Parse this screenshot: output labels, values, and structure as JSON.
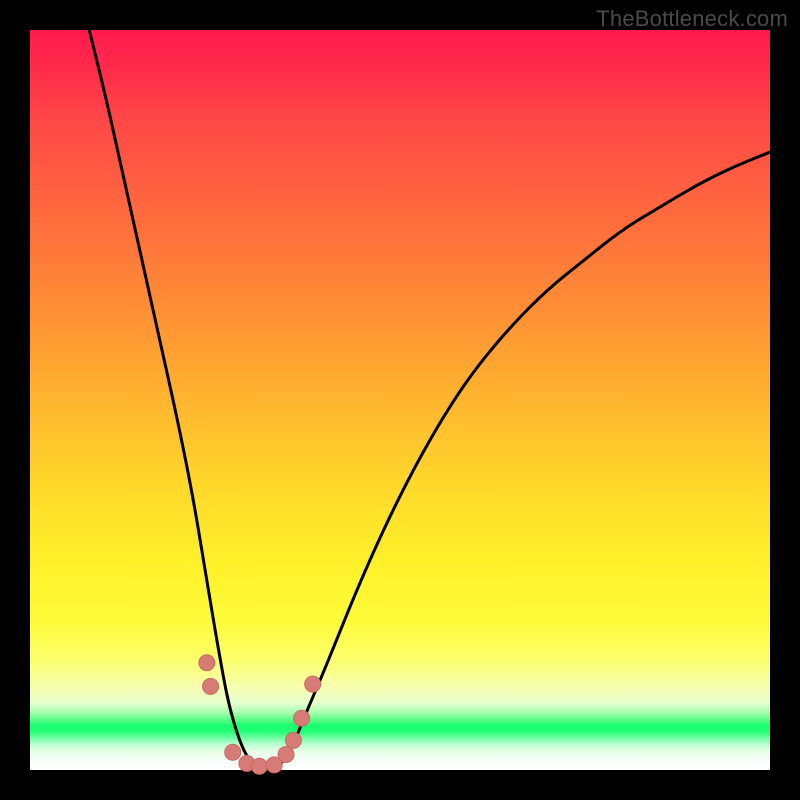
{
  "watermark": "TheBottleneck.com",
  "colors": {
    "page_bg": "#000000",
    "curve_stroke": "#000000",
    "marker_fill": "#d77b76",
    "marker_stroke": "#c96a64"
  },
  "chart_data": {
    "type": "line",
    "title": "",
    "xlabel": "",
    "ylabel": "",
    "xlim": [
      0,
      100
    ],
    "ylim": [
      0,
      100
    ],
    "grid": false,
    "legend": false,
    "series": [
      {
        "name": "bottleneck-curve",
        "x": [
          8,
          10,
          12,
          14,
          16,
          18,
          20,
          22,
          23.5,
          25.5,
          27,
          29,
          31,
          33,
          35,
          37,
          40,
          44,
          48,
          52,
          56,
          60,
          65,
          70,
          75,
          80,
          85,
          90,
          95,
          100
        ],
        "y": [
          100,
          92,
          83,
          74,
          65,
          56,
          47,
          37,
          28,
          16,
          8,
          2,
          0,
          0,
          2,
          7,
          14,
          24,
          33,
          41,
          48,
          54,
          60,
          65,
          69,
          73,
          76,
          79,
          81.5,
          83.5
        ]
      }
    ],
    "markers": [
      {
        "x": 23.9,
        "y": 14.5
      },
      {
        "x": 24.4,
        "y": 11.3
      },
      {
        "x": 27.4,
        "y": 2.4
      },
      {
        "x": 29.3,
        "y": 0.9
      },
      {
        "x": 31.0,
        "y": 0.5
      },
      {
        "x": 33.0,
        "y": 0.7
      },
      {
        "x": 34.6,
        "y": 2.1
      },
      {
        "x": 35.6,
        "y": 4.0
      },
      {
        "x": 36.7,
        "y": 7.0
      },
      {
        "x": 38.2,
        "y": 11.6
      }
    ]
  }
}
